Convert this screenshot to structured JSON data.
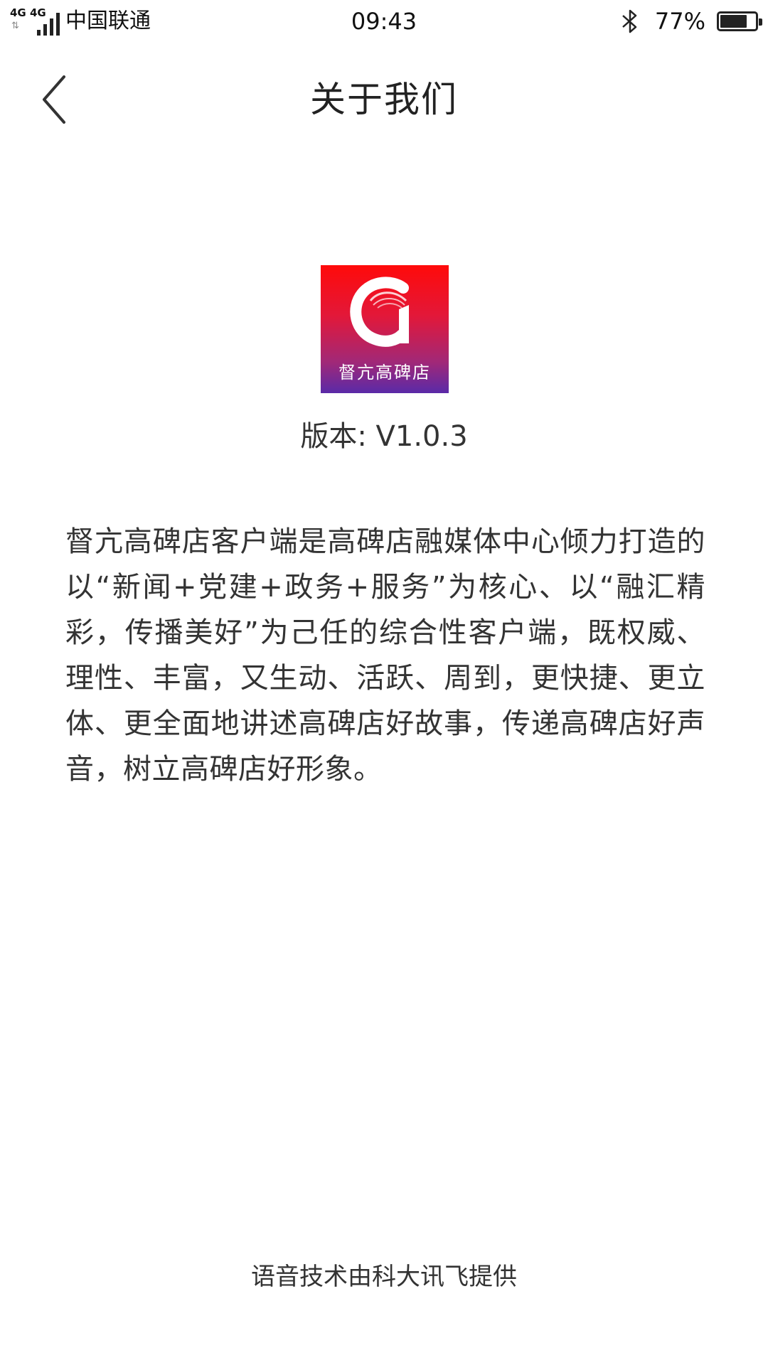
{
  "status_bar": {
    "network_1": "4G",
    "network_2": "4G",
    "carrier": "中国联通",
    "time": "09:43",
    "battery_percent": "77%",
    "battery_level": 0.77,
    "icons": [
      "signal-icon",
      "bluetooth-icon",
      "battery-icon"
    ]
  },
  "nav": {
    "back_icon": "chevron-left-icon",
    "title": "关于我们"
  },
  "app": {
    "logo_text": "督亢高碑店",
    "logo_colors": [
      "#ff0a0a",
      "#5a2aa8"
    ],
    "version": "版本:  V1.0.3"
  },
  "description": "督亢高碑店客户端是高碑店融媒体中心倾力打造的以“新闻+党建+政务+服务”为核心、以“融汇精彩，传播美好”为己任的综合性客户端，既权威、理性、丰富，又生动、活跃、周到，更快捷、更立体、更全面地讲述高碑店好故事，传递高碑店好声音，树立高碑店好形象。",
  "footer": {
    "credit": "语音技术由科大讯飞提供"
  }
}
